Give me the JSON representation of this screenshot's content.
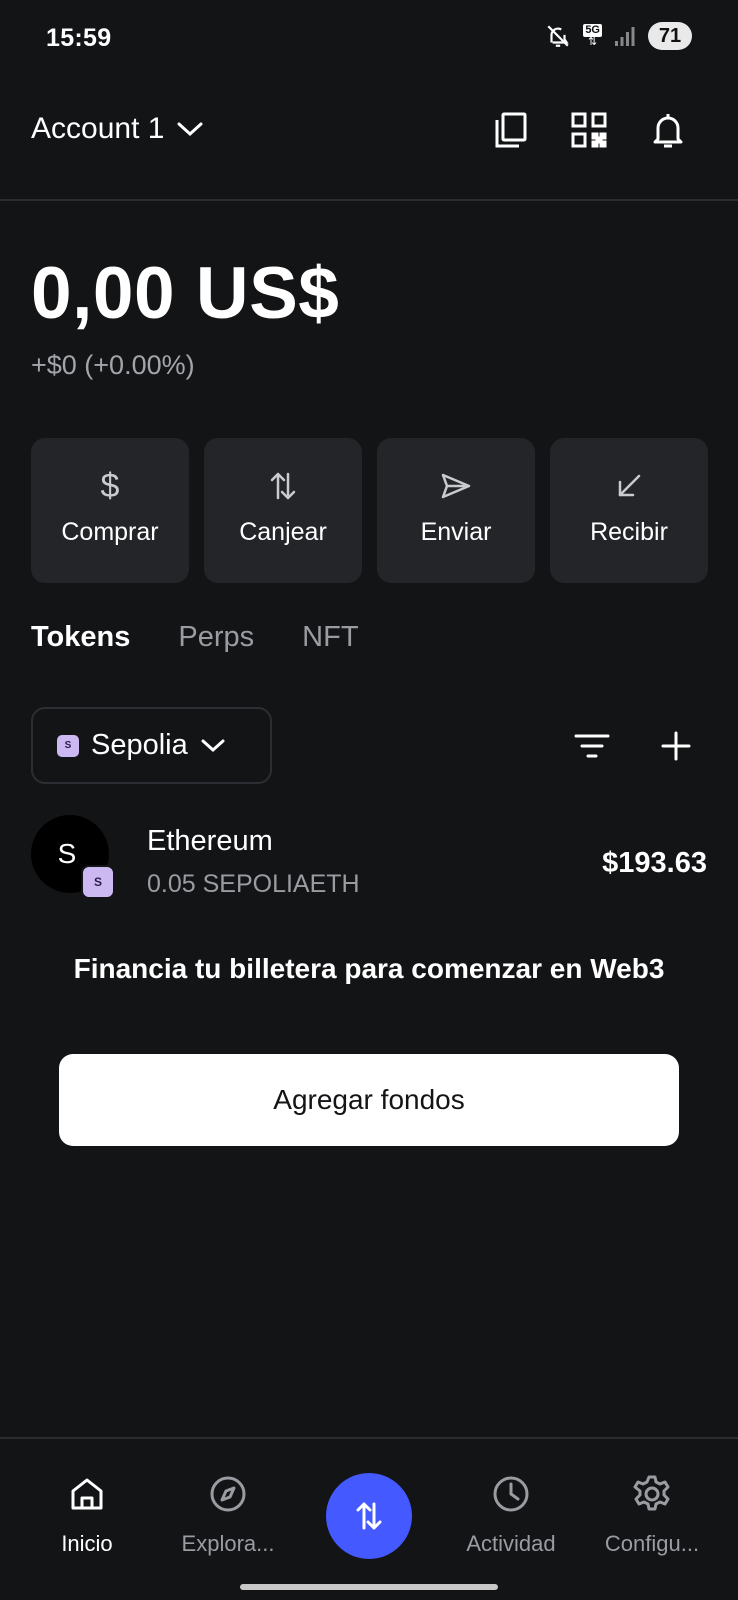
{
  "status_bar": {
    "time": "15:59",
    "network_type": "5G",
    "battery": "71"
  },
  "header": {
    "account_label": "Account 1",
    "icons": [
      "copy-icon",
      "qr-code-icon",
      "bell-icon"
    ]
  },
  "balance": {
    "amount": "0,00 US$",
    "change": "+$0 (+0.00%)"
  },
  "actions": [
    {
      "label": "Comprar",
      "icon": "dollar-icon"
    },
    {
      "label": "Canjear",
      "icon": "swap-arrows-icon"
    },
    {
      "label": "Enviar",
      "icon": "send-icon"
    },
    {
      "label": "Recibir",
      "icon": "receive-arrow-icon"
    }
  ],
  "tabs": [
    {
      "label": "Tokens",
      "active": true
    },
    {
      "label": "Perps",
      "active": false
    },
    {
      "label": "NFT",
      "active": false
    }
  ],
  "network_selector": {
    "badge": "S",
    "label": "Sepolia"
  },
  "tokens": [
    {
      "avatar_letter": "S",
      "network_badge": "S",
      "name": "Ethereum",
      "amount": "0.05 SEPOLIAETH",
      "value": "$193.63"
    }
  ],
  "fund_prompt": {
    "title": "Financia tu billetera para comenzar en Web3",
    "button_label": "Agregar fondos"
  },
  "bottom_nav": [
    {
      "label": "Inicio",
      "icon": "home-icon",
      "active": true
    },
    {
      "label": "Explora...",
      "icon": "compass-icon",
      "active": false
    },
    {
      "label": "Actividad",
      "icon": "clock-icon",
      "active": false
    },
    {
      "label": "Configu...",
      "icon": "gear-icon",
      "active": false
    }
  ],
  "colors": {
    "background": "#131416",
    "card": "#232529",
    "accent": "#4459ff",
    "network_badge": "#cdb9f2"
  }
}
